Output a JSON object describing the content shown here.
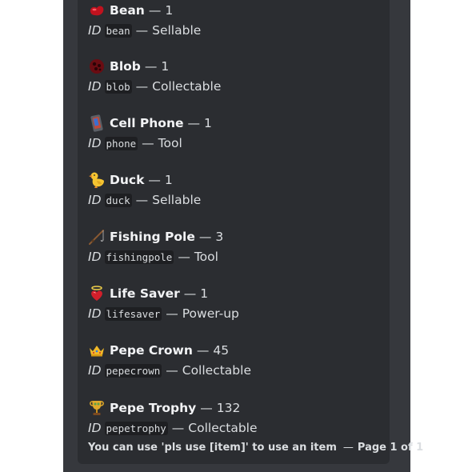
{
  "items": [
    {
      "emoji": "bean-icon",
      "name": "Bean",
      "qty": "1",
      "id_label": "ID",
      "id": "bean",
      "type": "Sellable"
    },
    {
      "emoji": "blob-icon",
      "name": "Blob",
      "qty": "1",
      "id_label": "ID",
      "id": "blob",
      "type": "Collectable"
    },
    {
      "emoji": "cell-phone-icon",
      "name": "Cell Phone",
      "qty": "1",
      "id_label": "ID",
      "id": "phone",
      "type": "Tool"
    },
    {
      "emoji": "duck-icon",
      "name": "Duck",
      "qty": "1",
      "id_label": "ID",
      "id": "duck",
      "type": "Sellable"
    },
    {
      "emoji": "fishing-pole-icon",
      "name": "Fishing Pole",
      "qty": "3",
      "id_label": "ID",
      "id": "fishingpole",
      "type": "Tool"
    },
    {
      "emoji": "life-saver-icon",
      "name": "Life Saver",
      "qty": "1",
      "id_label": "ID",
      "id": "lifesaver",
      "type": "Power-up"
    },
    {
      "emoji": "crown-icon",
      "name": "Pepe Crown",
      "qty": "45",
      "id_label": "ID",
      "id": "pepecrown",
      "type": "Collectable"
    },
    {
      "emoji": "trophy-icon",
      "name": "Pepe Trophy",
      "qty": "132",
      "id_label": "ID",
      "id": "pepetrophy",
      "type": "Collectable"
    }
  ],
  "separator": "—",
  "footer": {
    "hint": "You can use 'pls use [item]' to use an item",
    "sep": "—",
    "page": "Page 1 of 1"
  },
  "colors": {
    "background": "#36383d",
    "embed": "#2b2d31",
    "text": "#dbdee1",
    "name": "#f2f3f5"
  }
}
